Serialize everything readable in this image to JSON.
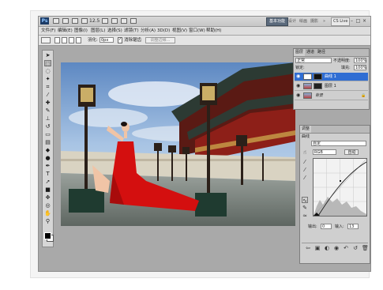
{
  "titlebar": {
    "logo": "Ps",
    "zoom": "12.5",
    "workspace_active": "基本功能",
    "workspace_links": [
      "设计",
      "绘画",
      "摄影"
    ],
    "more": "»",
    "cs_live": "CS Live",
    "win_buttons": [
      "–",
      "□",
      "×"
    ]
  },
  "menubar": {
    "items": [
      "文件(F)",
      "编辑(E)",
      "图像(I)",
      "图层(L)",
      "选择(S)",
      "滤镜(T)",
      "分析(A)",
      "3D(D)",
      "视图(V)",
      "窗口(W)",
      "帮助(H)"
    ]
  },
  "options": {
    "feather_label": "羽化:",
    "feather_value": "0px",
    "antialias_label": "消除锯齿",
    "refine_label": "调整边缘..."
  },
  "layers_panel": {
    "tabs": [
      "图层",
      "通道",
      "路径"
    ],
    "blend_mode": "正常",
    "opacity_label": "不透明度:",
    "opacity_value": "100%",
    "lock_label": "锁定:",
    "fill_label": "填充:",
    "fill_value": "100%",
    "layers": [
      {
        "name": "曲线 1",
        "selected": true
      },
      {
        "name": "图层 1",
        "selected": false
      },
      {
        "name": "背景",
        "selected": false
      }
    ]
  },
  "adjust_panel": {
    "tab": "调整",
    "title": "曲线",
    "preset": "自定",
    "channel": "RGB",
    "auto": "自动",
    "output_label": "输出:",
    "output_value": "0",
    "input_label": "输入:",
    "input_value": "13"
  },
  "colors": {
    "selected_layer": "#2f6dd3",
    "dress": "#d40f0f",
    "app_bg": "#a9a9a9"
  }
}
